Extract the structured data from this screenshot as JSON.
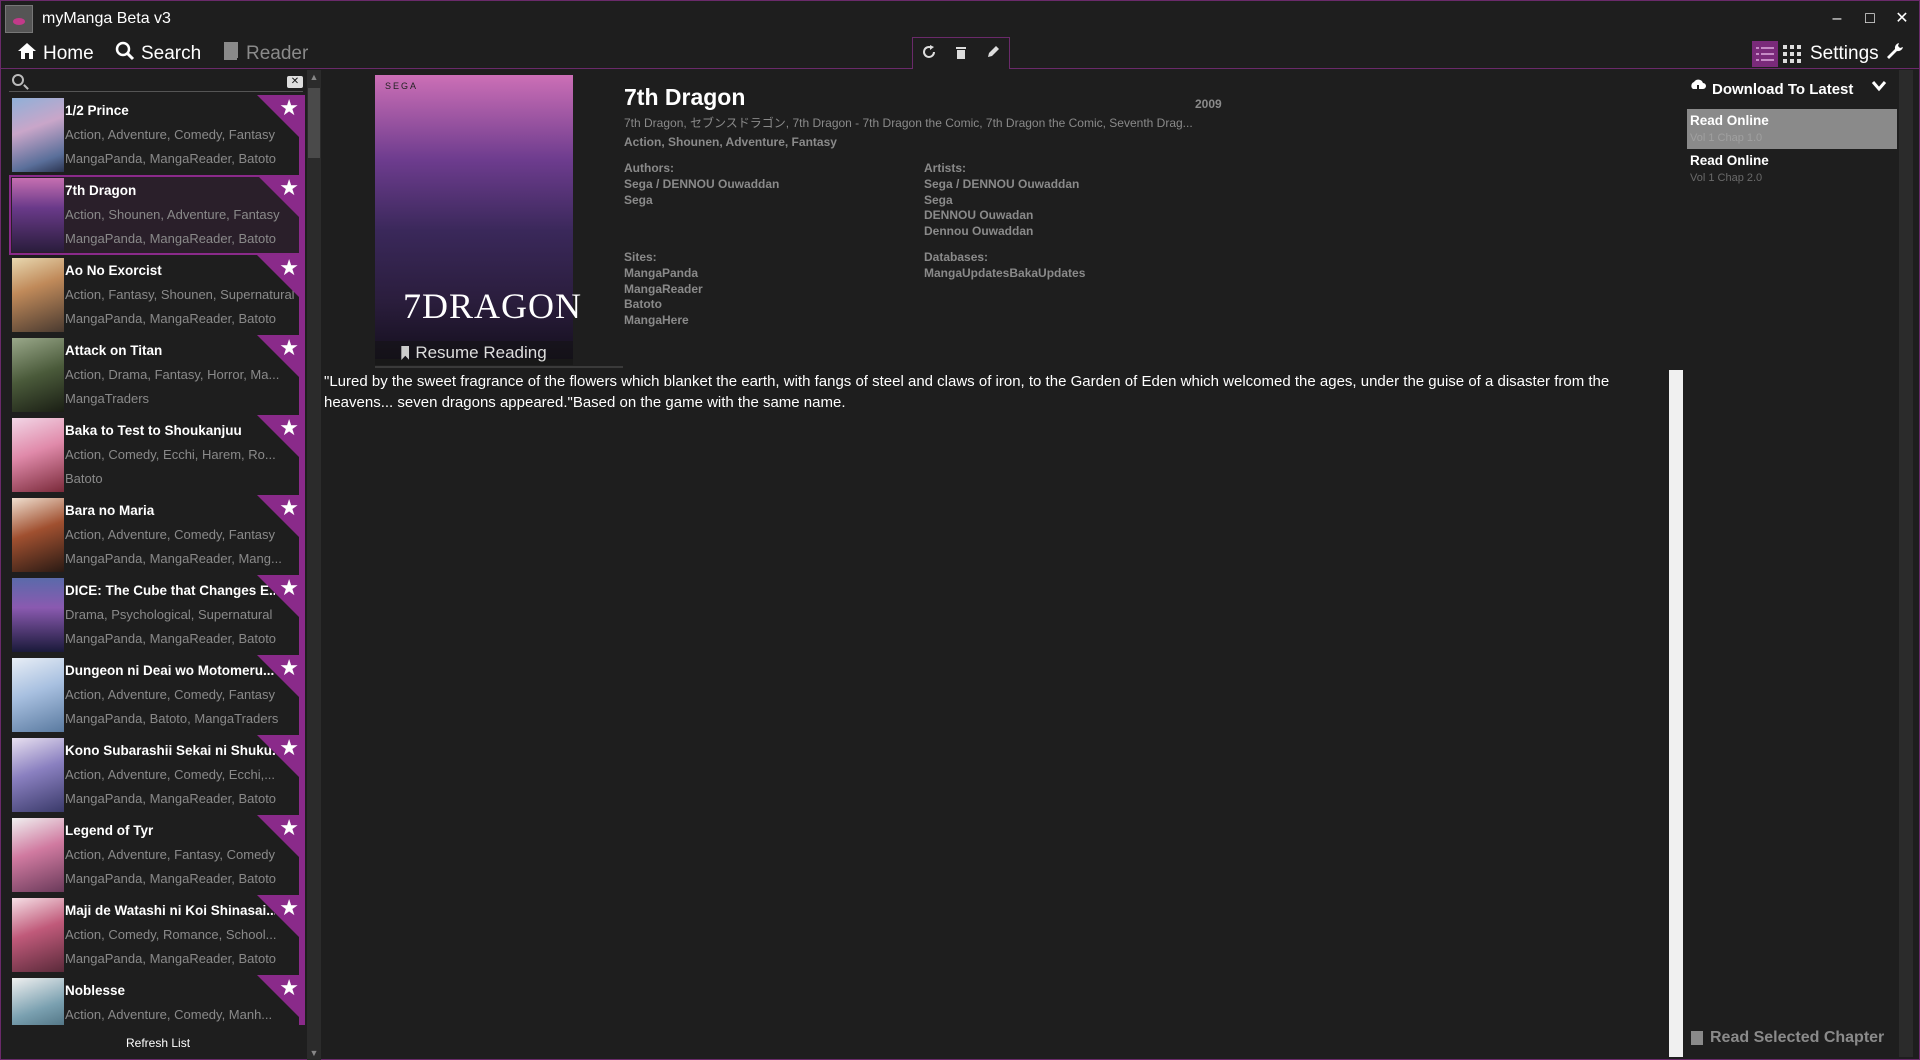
{
  "window": {
    "title": "myManga Beta v3",
    "minimize": "–",
    "maximize": "□",
    "close": "✕"
  },
  "nav": {
    "home": "Home",
    "search": "Search",
    "reader": "Reader",
    "settings": "Settings"
  },
  "toolbar": {
    "refresh_icon": "refresh-icon",
    "delete_icon": "trash-icon",
    "edit_icon": "pencil-icon"
  },
  "search": {
    "placeholder": "",
    "value": ""
  },
  "manga_list": [
    {
      "name": "1/2 Prince",
      "genres": "Action, Adventure, Comedy, Fantasy",
      "sites": "MangaPanda, MangaReader, Batoto"
    },
    {
      "name": "7th Dragon",
      "genres": "Action, Shounen, Adventure, Fantasy",
      "sites": "MangaPanda, MangaReader, Batoto"
    },
    {
      "name": "Ao No Exorcist",
      "genres": "Action, Fantasy, Shounen, Supernatural",
      "sites": "MangaPanda, MangaReader, Batoto"
    },
    {
      "name": "Attack on Titan",
      "genres": "Action, Drama, Fantasy, Horror, Ma...",
      "sites": "MangaTraders"
    },
    {
      "name": "Baka to Test to Shoukanjuu",
      "genres": "Action, Comedy, Ecchi, Harem, Ro...",
      "sites": "Batoto"
    },
    {
      "name": "Bara no Maria",
      "genres": "Action, Adventure, Comedy, Fantasy",
      "sites": "MangaPanda, MangaReader, Mang..."
    },
    {
      "name": "DICE: The Cube that Changes E...",
      "genres": "Drama, Psychological, Supernatural",
      "sites": "MangaPanda, MangaReader, Batoto"
    },
    {
      "name": "Dungeon ni Deai wo Motomeru...",
      "genres": "Action, Adventure, Comedy, Fantasy",
      "sites": "MangaPanda, Batoto, MangaTraders"
    },
    {
      "name": "Kono Subarashii Sekai ni Shuku...",
      "genres": "Action, Adventure, Comedy, Ecchi,...",
      "sites": "MangaPanda, MangaReader, Batoto"
    },
    {
      "name": "Legend of Tyr",
      "genres": "Action, Adventure, Fantasy, Comedy",
      "sites": "MangaPanda, MangaReader, Batoto"
    },
    {
      "name": "Maji de Watashi ni Koi Shinasai...",
      "genres": "Action, Comedy, Romance, School...",
      "sites": "MangaPanda, MangaReader, Batoto"
    },
    {
      "name": "Noblesse",
      "genres": "Action, Adventure, Comedy, Manh...",
      "sites": ""
    }
  ],
  "sidebar": {
    "refresh": "Refresh List"
  },
  "detail": {
    "title": "7th Dragon",
    "year": "2009",
    "alt_names": "7th Dragon, セブンスドラゴン, 7th Dragon - 7th Dragon the Comic, 7th Dragon the Comic, Seventh Drag...",
    "genres": "Action, Shounen, Adventure, Fantasy",
    "authors_label": "Authors:",
    "authors": [
      "Sega / DENNOU Ouwaddan",
      "Sega"
    ],
    "artists_label": "Artists:",
    "artists": [
      "Sega / DENNOU Ouwaddan",
      "Sega",
      "DENNOU Ouwadan",
      "Dennou Ouwaddan"
    ],
    "sites_label": "Sites:",
    "sites": [
      "MangaPanda",
      "MangaReader",
      "Batoto",
      "MangaHere"
    ],
    "databases_label": "Databases:",
    "databases": [
      "MangaUpdatesBakaUpdates"
    ],
    "cover_top": "SEGA",
    "cover_title": "7DRAGON",
    "resume": "Resume Reading",
    "summary": "\"Lured by the sweet fragrance of the flowers which blanket the earth, with fangs of steel and claws of iron, to the Garden of Eden which welcomed the ages, under the guise of a disaster from the heavens... seven dragons appeared.\"Based on the game with the same name."
  },
  "chapters": {
    "download": "Download To Latest",
    "items": [
      {
        "title": "Read Online",
        "sub": "Vol 1 Chap 1.0"
      },
      {
        "title": "Read Online",
        "sub": "Vol 1 Chap 2.0"
      }
    ],
    "read_selected": "Read Selected Chapter"
  },
  "colors": {
    "accent": "#8a2a8a",
    "background": "#1e1e1e"
  }
}
